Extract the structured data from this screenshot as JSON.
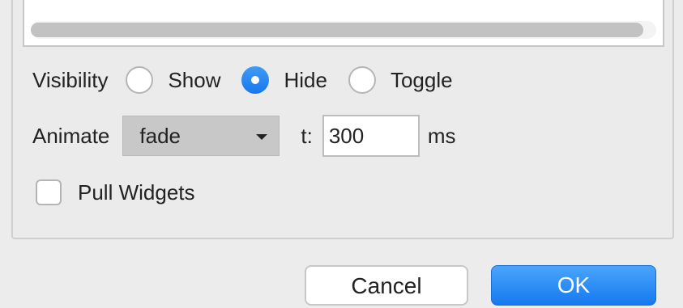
{
  "visibility": {
    "label": "Visibility",
    "options": [
      {
        "label": "Show",
        "checked": false
      },
      {
        "label": "Hide",
        "checked": true
      },
      {
        "label": "Toggle",
        "checked": false
      }
    ]
  },
  "animate": {
    "label": "Animate",
    "selected": "fade",
    "time_label": "t:",
    "time_value": "300",
    "unit": "ms"
  },
  "pull_widgets": {
    "label": "Pull Widgets",
    "checked": false
  },
  "buttons": {
    "cancel": "Cancel",
    "ok": "OK"
  },
  "colors": {
    "accent": "#1877ee",
    "background": "#ececec"
  }
}
